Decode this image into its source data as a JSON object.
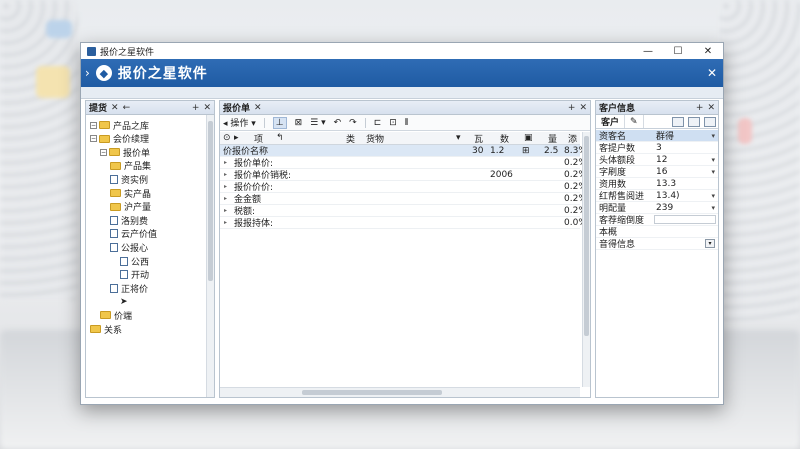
{
  "window": {
    "title": "报价之星软件",
    "minimize": "—",
    "maximize": "☐",
    "close": "✕"
  },
  "ribbon": {
    "chevron": "›",
    "logo_glyph": "◆",
    "app_name": "报价之星软件",
    "close": "✕"
  },
  "left_pane": {
    "title": "提货",
    "pin": "✕",
    "arrow": "←",
    "add": "+",
    "close": "✕",
    "tree": [
      {
        "label": "产品之库",
        "type": "folder",
        "depth": 0,
        "expander": "−"
      },
      {
        "label": "会价续理",
        "type": "folder",
        "depth": 0,
        "expander": "−"
      },
      {
        "label": "报价单",
        "type": "folder",
        "depth": 1,
        "expander": "−"
      },
      {
        "label": "产品集",
        "type": "folder",
        "depth": 2,
        "expander": ""
      },
      {
        "label": "资实例",
        "type": "doc",
        "depth": 2,
        "expander": ""
      },
      {
        "label": "实产晶",
        "type": "folder",
        "depth": 2,
        "expander": ""
      },
      {
        "label": "沪产量",
        "type": "folder",
        "depth": 2,
        "expander": ""
      },
      {
        "label": "洛别费",
        "type": "doc",
        "depth": 2,
        "expander": ""
      },
      {
        "label": "云产价值",
        "type": "doc",
        "depth": 2,
        "expander": ""
      },
      {
        "label": "公报心",
        "type": "doc",
        "depth": 2,
        "expander": ""
      },
      {
        "label": "公西",
        "type": "doc",
        "depth": 3,
        "expander": ""
      },
      {
        "label": "开动",
        "type": "doc",
        "depth": 3,
        "expander": ""
      },
      {
        "label": "正将价",
        "type": "doc",
        "depth": 2,
        "expander": ""
      },
      {
        "label": "➤",
        "type": "none",
        "depth": 3,
        "expander": ""
      },
      {
        "label": "价端",
        "type": "folder",
        "depth": 1,
        "expander": ""
      },
      {
        "label": "关系",
        "type": "folder",
        "depth": 0,
        "expander": ""
      }
    ]
  },
  "center_pane": {
    "title": "报价单",
    "pin": "✕",
    "add": "+",
    "close": "✕",
    "toolbar": [
      "◂ 操作 ▾",
      "⊥",
      "⊠",
      "☰ ▾",
      "↶",
      "↷",
      "⊏",
      "⊡",
      "⫴"
    ],
    "header": [
      "⊙",
      "▸",
      "项",
      "↰",
      "类",
      "货物",
      "▾",
      "瓦",
      "数",
      "▣",
      "量",
      "添"
    ],
    "rows": [
      {
        "name": "价报价名称",
        "c1": "30",
        "c2": "1.2",
        "icon": "⊞",
        "c3": "2.5",
        "pct": "8.3%"
      },
      {
        "name": "报价单价:",
        "c1": "",
        "c2": "",
        "icon": "",
        "c3": "",
        "pct": "0.2%"
      },
      {
        "name": "报价单价销税:",
        "c1": "",
        "c2": "2006",
        "icon": "",
        "c3": "",
        "pct": "0.2%"
      },
      {
        "name": "报价价价:",
        "c1": "",
        "c2": "",
        "icon": "",
        "c3": "",
        "pct": "0.2%"
      },
      {
        "name": "金金额",
        "c1": "",
        "c2": "",
        "icon": "",
        "c3": "",
        "pct": "0.2%"
      },
      {
        "name": "税额:",
        "c1": "",
        "c2": "",
        "icon": "",
        "c3": "",
        "pct": "0.2%"
      },
      {
        "name": "报报持体:",
        "c1": "",
        "c2": "",
        "icon": "",
        "c3": "",
        "pct": "0.0%"
      }
    ]
  },
  "right_pane": {
    "title": "客户信息",
    "add": "+",
    "close": "✕",
    "tabs": [
      "客户",
      "✎"
    ],
    "props": [
      {
        "name": "资客名",
        "value": "群得",
        "dd": "▾",
        "selected": true
      },
      {
        "name": "客提户数",
        "value": "3",
        "dd": ""
      },
      {
        "name": "头体额段",
        "value": "12",
        "dd": "▾"
      },
      {
        "name": "字刷度",
        "value": "16",
        "dd": "▾"
      },
      {
        "name": "资用数",
        "value": "13.3",
        "dd": ""
      },
      {
        "name": "红帮售阅进",
        "value": "13.4)",
        "dd": "▾"
      },
      {
        "name": "明配量",
        "value": "239",
        "dd": "▾"
      },
      {
        "name": "客荐缩倒度",
        "value": "",
        "dd": ""
      },
      {
        "name": "本概",
        "value": "",
        "dd": ""
      },
      {
        "name": "音得信息",
        "value": "",
        "dd": ""
      }
    ],
    "desc_button": "▾"
  }
}
